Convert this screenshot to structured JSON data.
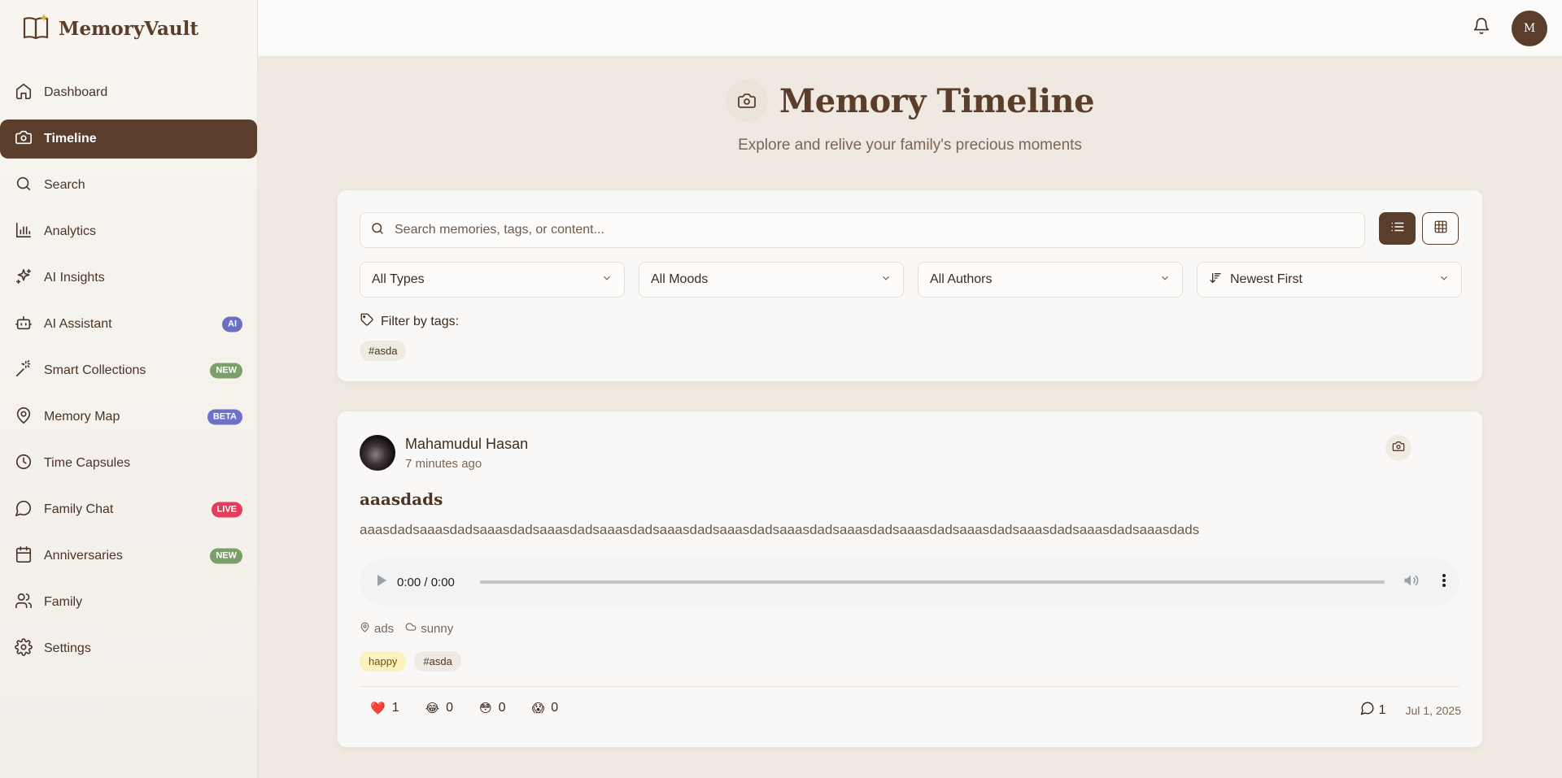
{
  "app": {
    "name": "MemoryVault"
  },
  "topbar": {
    "user_initial": "M"
  },
  "sidebar": {
    "items": [
      {
        "label": "Dashboard",
        "icon": "home-icon"
      },
      {
        "label": "Timeline",
        "icon": "camera-icon",
        "active": true
      },
      {
        "label": "Search",
        "icon": "search-icon"
      },
      {
        "label": "Analytics",
        "icon": "bar-chart-icon"
      },
      {
        "label": "AI Insights",
        "icon": "sparkles-icon"
      },
      {
        "label": "AI Assistant",
        "icon": "bot-icon",
        "badge": "AI",
        "badge_color": "#6b6fc4"
      },
      {
        "label": "Smart Collections",
        "icon": "wand-icon",
        "badge": "NEW",
        "badge_color": "#7aa06a"
      },
      {
        "label": "Memory Map",
        "icon": "map-pin-icon",
        "badge": "BETA",
        "badge_color": "#6d72c8"
      },
      {
        "label": "Time Capsules",
        "icon": "clock-icon"
      },
      {
        "label": "Family Chat",
        "icon": "chat-icon",
        "badge": "LIVE",
        "badge_color": "#e83a5c"
      },
      {
        "label": "Anniversaries",
        "icon": "calendar-icon",
        "badge": "NEW",
        "badge_color": "#7aa06a"
      },
      {
        "label": "Family",
        "icon": "users-icon"
      },
      {
        "label": "Settings",
        "icon": "gear-icon"
      }
    ]
  },
  "header": {
    "title": "Memory Timeline",
    "subtitle": "Explore and relive your family's precious moments"
  },
  "filters": {
    "search_placeholder": "Search memories, tags, or content...",
    "search_value": "",
    "type": "All Types",
    "mood": "All Moods",
    "author": "All Authors",
    "sort": "Newest First",
    "tags_label": "Filter by tags:",
    "tags": [
      "#asda"
    ]
  },
  "memory": {
    "author": "Mahamudul Hasan",
    "time_ago": "7 minutes ago",
    "title": "aaasdads",
    "content": "aaasdadsaaasdadsaaasdadsaaasdadsaaasdadsaaasdadsaaasdadsaaasdadsaaasdadsaaasdadsaaasdadsaaasdadsaaasdadsaaasdads",
    "audio_time": "0:00 / 0:00",
    "location": "ads",
    "weather": "sunny",
    "tags": [
      "happy",
      "#asda"
    ],
    "reactions": [
      {
        "emoji": "❤️",
        "count": "1"
      },
      {
        "emoji": "😂",
        "count": "0"
      },
      {
        "emoji": "😳",
        "count": "0"
      },
      {
        "emoji": "😱",
        "count": "0"
      }
    ],
    "comments": "1",
    "date": "Jul 1, 2025"
  }
}
